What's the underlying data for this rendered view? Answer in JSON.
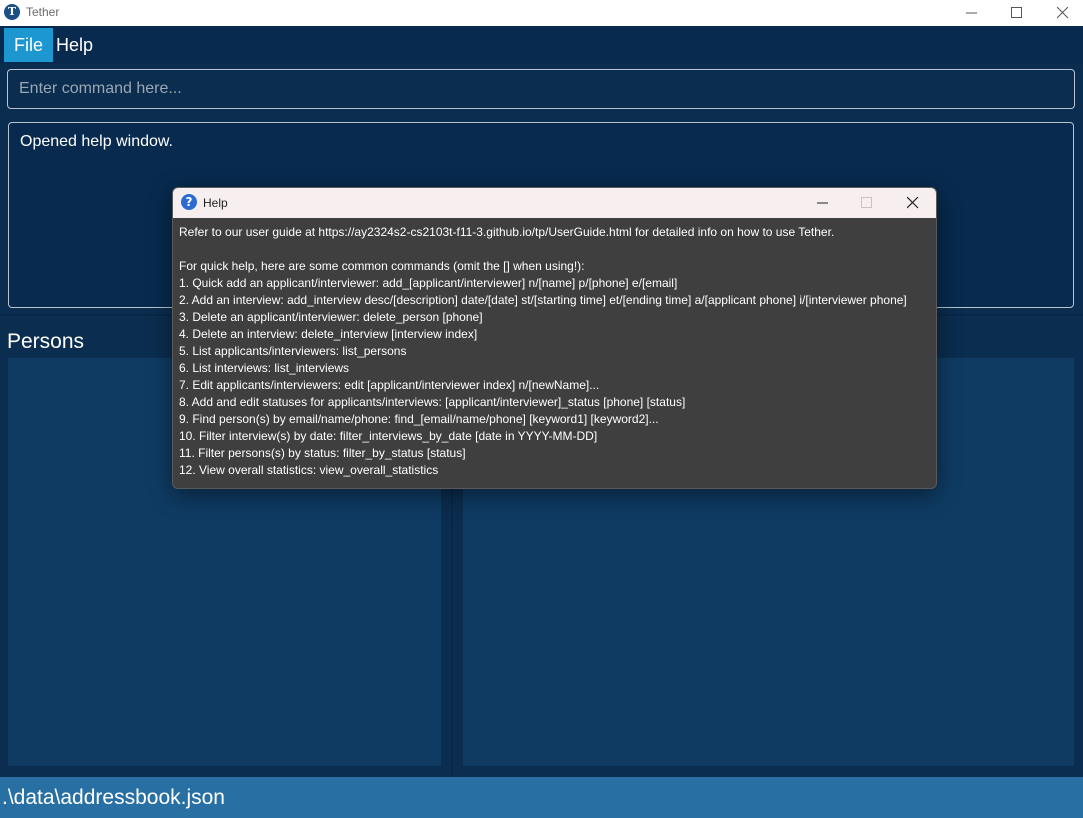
{
  "window": {
    "title": "Tether",
    "app_icon_glyph": "T"
  },
  "menubar": {
    "items": [
      {
        "label": "File"
      },
      {
        "label": "Help"
      }
    ]
  },
  "command": {
    "placeholder": "Enter command here...",
    "value": ""
  },
  "result": {
    "text": "Opened help window."
  },
  "persons": {
    "title": "Persons"
  },
  "statusbar": {
    "path": ".\\data\\addressbook.json"
  },
  "help_dialog": {
    "title": "Help",
    "icon_glyph": "?",
    "intro": "Refer to our user guide at https://ay2324s2-cs2103t-f11-3.github.io/tp/UserGuide.html for detailed info on how to use Tether.",
    "quick_help": "For quick help, here are some common commands (omit the [] when using!):",
    "commands": [
      "1. Quick add an applicant/interviewer: add_[applicant/interviewer] n/[name] p/[phone] e/[email]",
      "2. Add an interview: add_interview desc/[description] date/[date] st/[starting time] et/[ending time] a/[applicant phone] i/[interviewer phone]",
      "3. Delete an applicant/interviewer: delete_person [phone]",
      "4. Delete an interview: delete_interview [interview index]",
      "5. List applicants/interviewers: list_persons",
      "6. List interviews: list_interviews",
      "7. Edit applicants/interviewers: edit [applicant/interviewer index] n/[newName]...",
      "8. Add and edit statuses for applicants/interviews: [applicant/interviewer]_status [phone] [status]",
      "9. Find person(s) by email/name/phone: find_[email/name/phone] [keyword1] [keyword2]...",
      "10. Filter interview(s) by date: filter_interviews_by_date [date in YYYY-MM-DD]",
      "11. Filter persons(s) by status: filter_by_status [status]",
      "12. View overall statistics: view_overall_statistics"
    ]
  },
  "colors": {
    "background": "#0b2d4f",
    "accent": "#1c97cf",
    "statusbar": "#2870a4",
    "list_panel": "#0f3b63",
    "dialog_body": "#3f3f3f"
  }
}
